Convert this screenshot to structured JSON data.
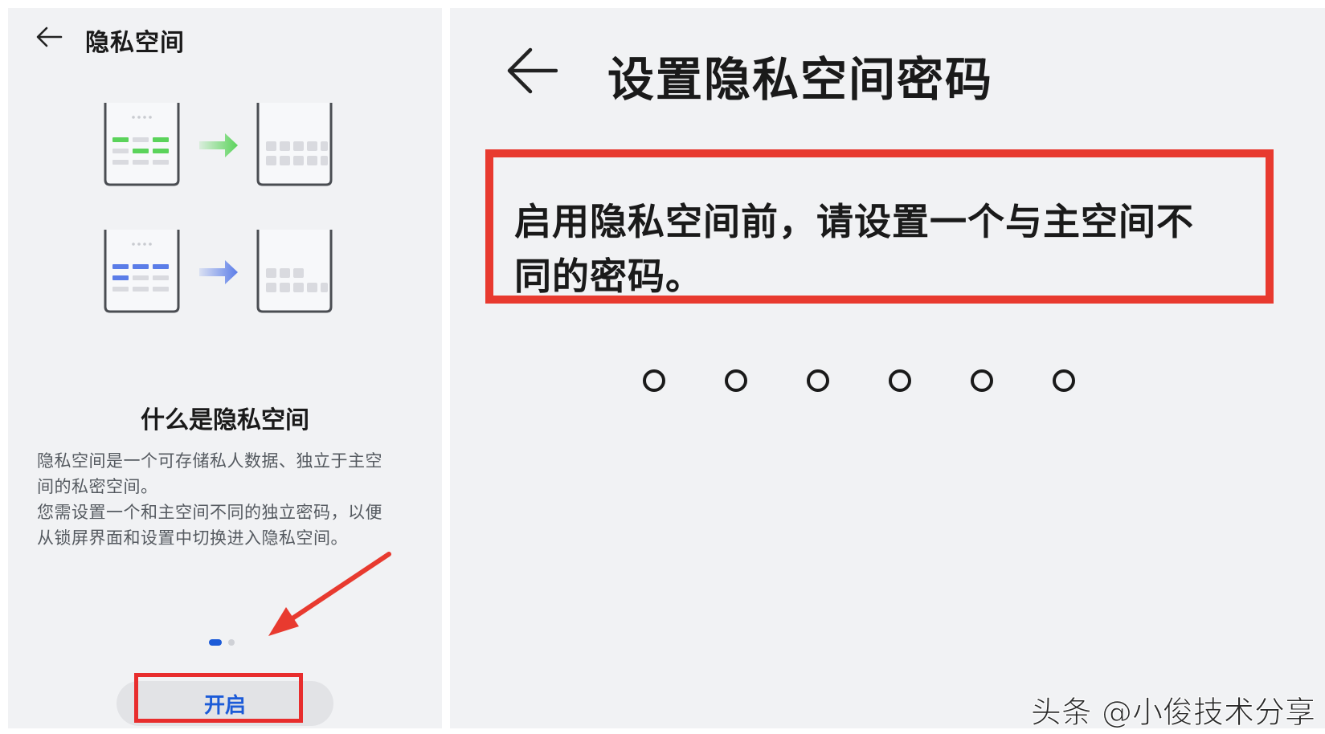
{
  "left_screen": {
    "title": "隐私空间",
    "illustration": {
      "green_color": "#5bd35b",
      "blue_color": "#5b7de8",
      "icons": [
        "phone-main-space-icon",
        "green-arrow-icon",
        "phone-private-space-icon"
      ]
    },
    "intro_heading": "什么是隐私空间",
    "intro_lines": [
      "隐私空间是一个可存储私人数据、独立于主空",
      "间的私密空间。",
      "您需设置一个和主空间不同的独立密码，以便",
      "从锁屏界面和设置中切换进入隐私空间。"
    ],
    "pager": {
      "page": 1,
      "total": 2
    },
    "enable_button_label": "开启",
    "accent_color": "#1c5bd8"
  },
  "right_screen": {
    "title": "设置隐私空间密码",
    "message_lines": [
      "启用隐私空间前，请设置一个与主空间不",
      "同的密码。"
    ],
    "pin_length": 6,
    "pin_entered": 0
  },
  "annotation_color": "#e83a2f",
  "watermark": "头条 @小俊技术分享"
}
